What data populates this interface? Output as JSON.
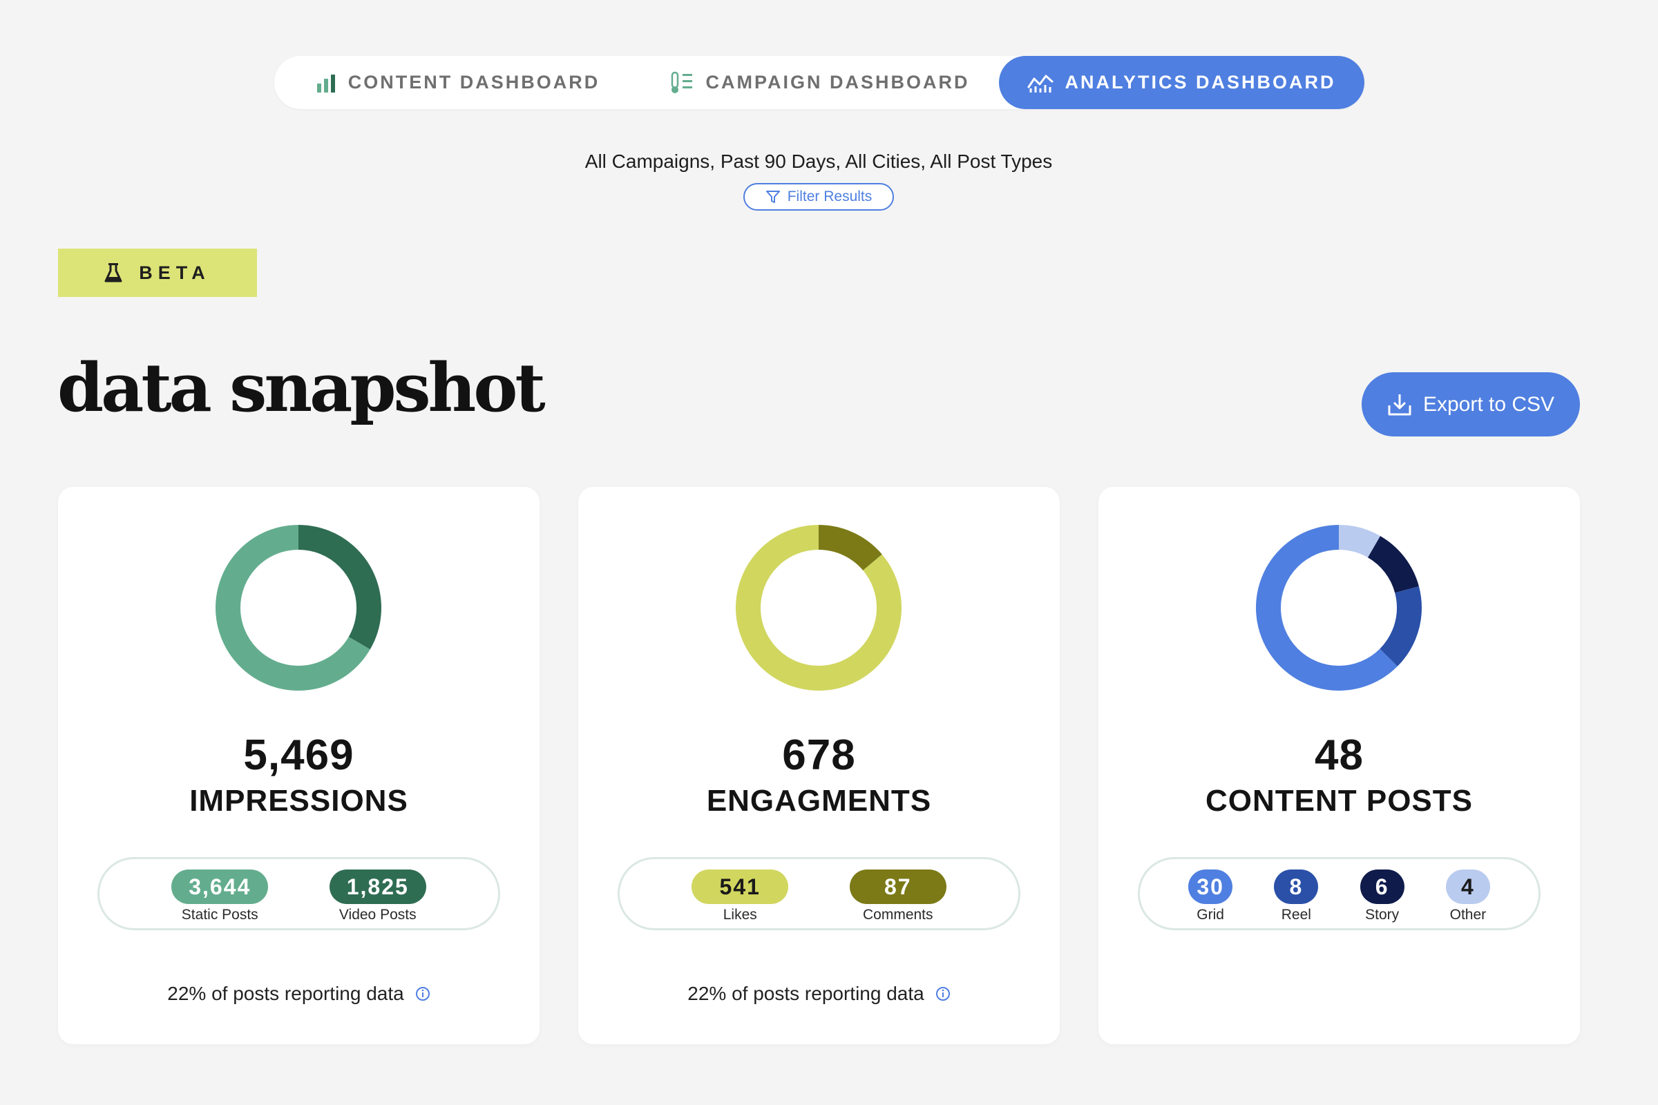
{
  "tabs": [
    {
      "label": "CONTENT DASHBOARD",
      "icon": "bar-chart-icon",
      "active": false
    },
    {
      "label": "CAMPAIGN DASHBOARD",
      "icon": "thermometer-list-icon",
      "active": false
    },
    {
      "label": "ANALYTICS DASHBOARD",
      "icon": "line-trend-icon",
      "active": true
    }
  ],
  "filter": {
    "summary": "All Campaigns, Past 90 Days, All Cities, All Post Types",
    "button_label": "Filter Results",
    "icon": "funnel-icon"
  },
  "beta": {
    "label": "BETA",
    "icon": "flask-icon"
  },
  "page": {
    "title": "data snapshot"
  },
  "export": {
    "label": "Export to CSV",
    "icon": "download-icon"
  },
  "colors": {
    "accent": "#4f7fe0",
    "beta_bg": "#dde477",
    "green_light": "#63ad8e",
    "green_dark": "#2f6d53",
    "yellow_light": "#d1d65f",
    "yellow_dark": "#7b7a17",
    "blue_mid": "#4f7fe0",
    "blue_dark": "#2a50a8",
    "blue_navy": "#0f1b4b",
    "blue_pale": "#b9cbef"
  },
  "cards": [
    {
      "value": "5,469",
      "label": "IMPRESSIONS",
      "segments": [
        {
          "value": 3644,
          "display": "3,644",
          "caption": "Static Posts",
          "color": "#63ad8e",
          "text_color": "#ffffff"
        },
        {
          "value": 1825,
          "display": "1,825",
          "caption": "Video Posts",
          "color": "#2f6d53",
          "text_color": "#ffffff"
        }
      ],
      "footnote": "22% of posts reporting data"
    },
    {
      "value": "678",
      "label": "ENGAGMENTS",
      "segments": [
        {
          "value": 541,
          "display": "541",
          "caption": "Likes",
          "color": "#d1d65f",
          "text_color": "#1a1a1a"
        },
        {
          "value": 87,
          "display": "87",
          "caption": "Comments",
          "color": "#7b7a17",
          "text_color": "#ffffff"
        }
      ],
      "footnote": "22% of posts reporting data"
    },
    {
      "value": "48",
      "label": "CONTENT POSTS",
      "segments": [
        {
          "value": 30,
          "display": "30",
          "caption": "Grid",
          "color": "#4f7fe0",
          "text_color": "#ffffff"
        },
        {
          "value": 8,
          "display": "8",
          "caption": "Reel",
          "color": "#2a50a8",
          "text_color": "#ffffff"
        },
        {
          "value": 6,
          "display": "6",
          "caption": "Story",
          "color": "#0f1b4b",
          "text_color": "#ffffff"
        },
        {
          "value": 4,
          "display": "4",
          "caption": "Other",
          "color": "#b9cbef",
          "text_color": "#1a1a1a"
        }
      ],
      "footnote": ""
    }
  ]
}
